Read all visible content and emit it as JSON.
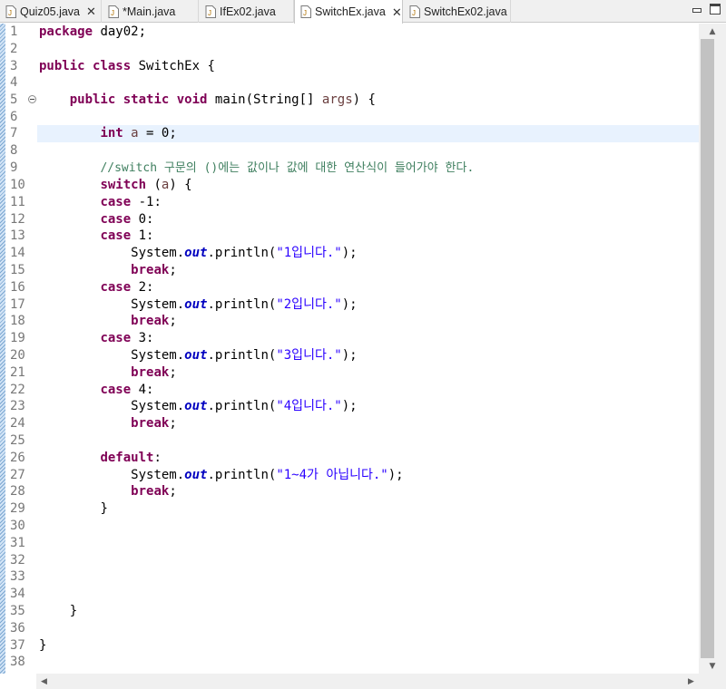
{
  "tabs": [
    {
      "label": "Quiz05.java",
      "has_close": true
    },
    {
      "label": "*Main.java",
      "has_close": false
    },
    {
      "label": "IfEx02.java",
      "has_close": false
    },
    {
      "label": "SwitchEx.java",
      "has_close": true,
      "active": true
    },
    {
      "label": "SwitchEx02.java",
      "has_close": false
    }
  ],
  "tab_controls": [
    "minimize-icon",
    "maximize-icon"
  ],
  "editor": {
    "current_line": 7,
    "line_numbers": [
      "1",
      "2",
      "3",
      "4",
      "5",
      "6",
      "7",
      "8",
      "9",
      "10",
      "11",
      "12",
      "13",
      "14",
      "15",
      "16",
      "17",
      "18",
      "19",
      "20",
      "21",
      "22",
      "23",
      "24",
      "25",
      "26",
      "27",
      "28",
      "29",
      "30",
      "31",
      "32",
      "33",
      "34",
      "35",
      "36",
      "37",
      "38"
    ],
    "tokens": {
      "package": "package",
      "package_name": " day02;",
      "public": "public",
      "class": "class",
      "class_name": " SwitchEx {",
      "static": "static",
      "void": "void",
      "main_sig_1": " main(String[] ",
      "args": "args",
      "main_sig_2": ") {",
      "int": "int",
      "var_a": "a",
      "assign_0": " = 0;",
      "comment": "//switch 구문의 ()에는 값이나 값에 대한 연산식이 들어가야 한다.",
      "switch": "switch",
      "switch_open": " (",
      "switch_close": ") {",
      "case": "case",
      "case_m1": " -1:",
      "case_0": " 0:",
      "case_1": " 1:",
      "case_2": " 2:",
      "case_3": " 3:",
      "case_4": " 4:",
      "system": "System.",
      "out": "out",
      "println_open": ".println(",
      "println_close": ");",
      "str_1": "\"1입니다.\"",
      "str_2": "\"2입니다.\"",
      "str_3": "\"3입니다.\"",
      "str_4": "\"4입니다.\"",
      "str_default": "\"1~4가 아닙니다.\"",
      "break": "break",
      "semicolon": ";",
      "default": "default",
      "colon": ":",
      "close_brace": "}"
    }
  }
}
